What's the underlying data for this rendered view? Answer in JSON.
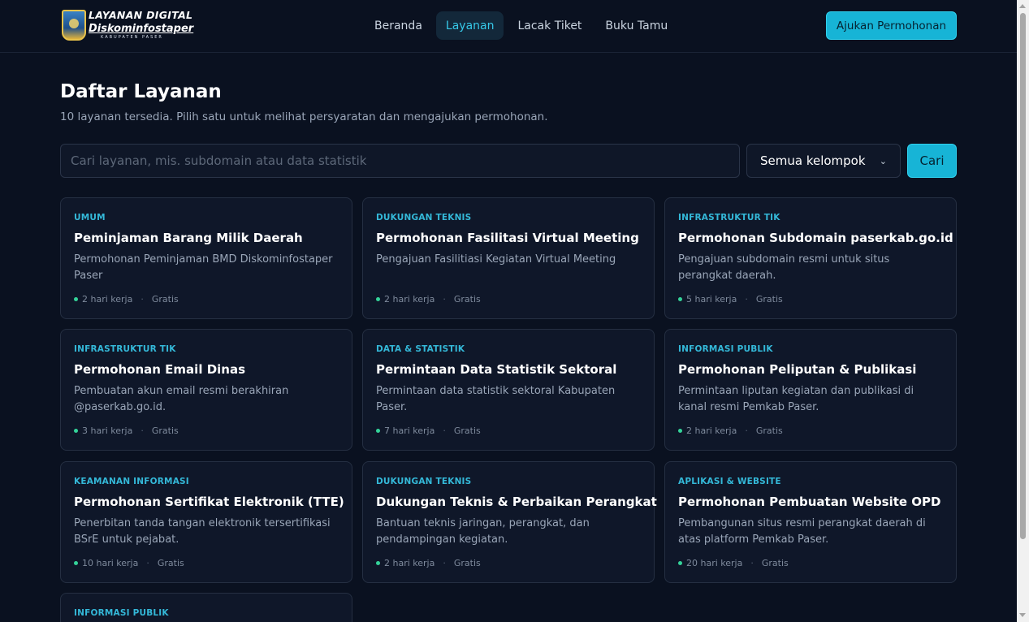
{
  "header": {
    "logo": {
      "line1": "LAYANAN DIGITAL",
      "line2": "Diskominfostaper",
      "line3": "KABUPATEN PASER"
    },
    "nav": [
      {
        "label": "Beranda"
      },
      {
        "label": "Layanan"
      },
      {
        "label": "Lacak Tiket"
      },
      {
        "label": "Buku Tamu"
      }
    ],
    "active_nav": "Layanan",
    "cta_label": "Ajukan Permohonan"
  },
  "main": {
    "title": "Daftar Layanan",
    "subtitle": "10 layanan tersedia. Pilih satu untuk melihat persyaratan dan mengajukan permohonan.",
    "search": {
      "placeholder": "Cari layanan, mis. subdomain atau data statistik",
      "value": "",
      "group_selected": "Semua kelompok",
      "button_label": "Cari"
    },
    "cards": [
      {
        "category": "UMUM",
        "title": "Peminjaman Barang Milik Daerah",
        "description": "Permohonan Peminjaman BMD Diskominfostaper Paser",
        "duration": "2 hari kerja",
        "price": "Gratis"
      },
      {
        "category": "DUKUNGAN TEKNIS",
        "title": "Permohonan Fasilitasi Virtual Meeting",
        "description": "Pengajuan Fasilitiasi Kegiatan Virtual Meeting",
        "duration": "2 hari kerja",
        "price": "Gratis"
      },
      {
        "category": "INFRASTRUKTUR TIK",
        "title": "Permohonan Subdomain paserkab.go.id",
        "description": "Pengajuan subdomain resmi untuk situs perangkat daerah.",
        "duration": "5 hari kerja",
        "price": "Gratis"
      },
      {
        "category": "INFRASTRUKTUR TIK",
        "title": "Permohonan Email Dinas",
        "description": "Pembuatan akun email resmi berakhiran @paserkab.go.id.",
        "duration": "3 hari kerja",
        "price": "Gratis"
      },
      {
        "category": "DATA & STATISTIK",
        "title": "Permintaan Data Statistik Sektoral",
        "description": "Permintaan data statistik sektoral Kabupaten Paser.",
        "duration": "7 hari kerja",
        "price": "Gratis"
      },
      {
        "category": "INFORMASI PUBLIK",
        "title": "Permohonan Peliputan & Publikasi",
        "description": "Permintaan liputan kegiatan dan publikasi di kanal resmi Pemkab Paser.",
        "duration": "2 hari kerja",
        "price": "Gratis"
      },
      {
        "category": "KEAMANAN INFORMASI",
        "title": "Permohonan Sertifikat Elektronik (TTE)",
        "description": "Penerbitan tanda tangan elektronik tersertifikasi BSrE untuk pejabat.",
        "duration": "10 hari kerja",
        "price": "Gratis"
      },
      {
        "category": "DUKUNGAN TEKNIS",
        "title": "Dukungan Teknis & Perbaikan Perangkat",
        "description": "Bantuan teknis jaringan, perangkat, dan pendampingan kegiatan.",
        "duration": "2 hari kerja",
        "price": "Gratis"
      },
      {
        "category": "APLIKASI & WEBSITE",
        "title": "Permohonan Pembuatan Website OPD",
        "description": "Pembangunan situs resmi perangkat daerah di atas platform Pemkab Paser.",
        "duration": "20 hari kerja",
        "price": "Gratis"
      },
      {
        "category": "INFORMASI PUBLIK",
        "title": "",
        "description": "",
        "duration": "",
        "price": ""
      }
    ]
  },
  "colors": {
    "background": "#0a1120",
    "card": "#0f1729",
    "accent": "#17b4d6",
    "category": "#34b8d8",
    "status_dot": "#34d399"
  }
}
